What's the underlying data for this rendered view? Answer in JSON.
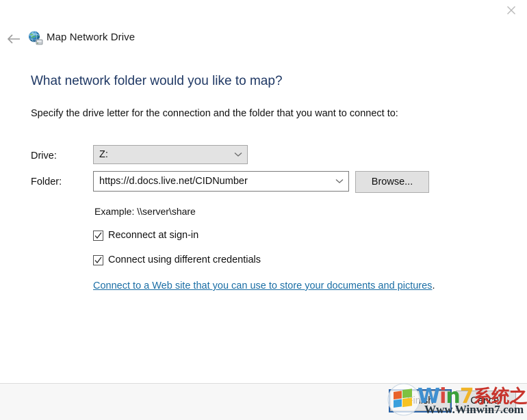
{
  "window": {
    "title": "Map Network Drive",
    "app_icon": "network-drive-icon",
    "close_label": "✕",
    "back_label": "←"
  },
  "content": {
    "heading": "What network folder would you like to map?",
    "subtext": "Specify the drive letter for the connection and the folder that you want to connect to:",
    "heading_color": "#1f3864"
  },
  "fields": {
    "drive": {
      "label": "Drive:",
      "value": "Z:",
      "chevron": "chevron-down-icon"
    },
    "folder": {
      "label": "Folder:",
      "value": "https://d.docs.live.net/CIDNumber",
      "placeholder": "",
      "chevron": "chevron-down-icon"
    },
    "browse_label": "Browse...",
    "example": "Example: \\\\server\\share"
  },
  "checkboxes": [
    {
      "label": "Reconnect at sign-in",
      "checked": true
    },
    {
      "label": "Connect using different credentials",
      "checked": true
    }
  ],
  "link": {
    "text": "Connect to a Web site that you can use to store your documents and pictures",
    "period": ".",
    "color": "#1a6ea5"
  },
  "footer": {
    "finish_label": "Finish",
    "cancel_label": "Cancel",
    "focus_color": "#2a63a8"
  },
  "watermark": {
    "brand_w": "W",
    "brand_i": "i",
    "brand_n": "n",
    "brand_seven": "7",
    "brand_cn": "系统之家",
    "url": "Www.Winwin7.com"
  }
}
